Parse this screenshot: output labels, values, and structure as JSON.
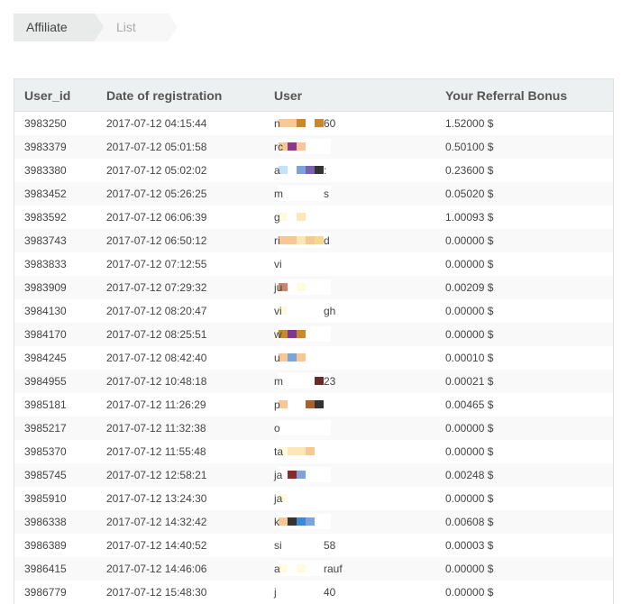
{
  "breadcrumb": {
    "items": [
      "Affiliate",
      "List"
    ]
  },
  "table": {
    "headers": [
      "User_id",
      "Date of registration",
      "User",
      "Your Referral Bonus"
    ],
    "rows": [
      {
        "id": "3983250",
        "date": "2017-07-12 04:15:44",
        "user_pre": "n",
        "user_suf": "60",
        "bonus": "1.52000 $",
        "blocks": [
          "#f5c896",
          "#f5c896",
          "#c8882d",
          "#ffffff",
          "#c8882d"
        ]
      },
      {
        "id": "3983379",
        "date": "2017-07-12 05:01:58",
        "user_pre": "rc",
        "user_suf": "",
        "bonus": "0.50100 $",
        "blocks": [
          "#f5c896",
          "#8b3a8f",
          "#f5c896"
        ]
      },
      {
        "id": "3983380",
        "date": "2017-07-12 05:02:02",
        "user_pre": "a",
        "user_suf": ":",
        "bonus": "0.23600 $",
        "blocks": [
          "#c5e3f7",
          "#ffffff",
          "#7aa5d8",
          "#7a62b0",
          "#333333"
        ]
      },
      {
        "id": "3983452",
        "date": "2017-07-12 05:26:25",
        "user_pre": "m",
        "user_suf": "s",
        "bonus": "0.05020 $",
        "blocks": []
      },
      {
        "id": "3983592",
        "date": "2017-07-12 06:06:39",
        "user_pre": "g",
        "user_suf": "",
        "bonus": "1.00093 $",
        "blocks": [
          "#fffbe0",
          "#ffffff",
          "#fde7b8"
        ]
      },
      {
        "id": "3983743",
        "date": "2017-07-12 06:50:12",
        "user_pre": "ri",
        "user_suf": "d",
        "bonus": "0.00000 $",
        "blocks": [
          "#f5c896",
          "#f5c896",
          "#fde7b8",
          "#f5c896",
          "#f5d890"
        ]
      },
      {
        "id": "3983833",
        "date": "2017-07-12 07:12:55",
        "user_pre": "vi",
        "user_suf": "",
        "bonus": "0.00000 $",
        "blocks": []
      },
      {
        "id": "3983909",
        "date": "2017-07-12 07:29:32",
        "user_pre": "ju",
        "user_suf": "",
        "bonus": "0.00209 $",
        "blocks": [
          "#c8866a",
          "#ffffff",
          "#fffbe0"
        ]
      },
      {
        "id": "3984130",
        "date": "2017-07-12 08:20:47",
        "user_pre": "vi",
        "user_suf": "gh",
        "bonus": "0.00000 $",
        "blocks": [
          "#fffbe0"
        ]
      },
      {
        "id": "3984170",
        "date": "2017-07-12 08:25:51",
        "user_pre": "w",
        "user_suf": "",
        "bonus": "0.00000 $",
        "blocks": [
          "#c8882d",
          "#7a3a8f",
          "#c8882d"
        ]
      },
      {
        "id": "3984245",
        "date": "2017-07-12 08:42:40",
        "user_pre": "u",
        "user_suf": "",
        "bonus": "0.00010 $",
        "blocks": [
          "#f5c896",
          "#7aa5d8",
          "#f5c896"
        ]
      },
      {
        "id": "3984955",
        "date": "2017-07-12 10:48:18",
        "user_pre": "m",
        "user_suf": "23",
        "bonus": "0.00021 $",
        "blocks": [
          "#ffffff",
          "#ffffff",
          "#ffffff",
          "#ffffff",
          "#6a2a2a"
        ]
      },
      {
        "id": "3985181",
        "date": "2017-07-12 11:26:29",
        "user_pre": "p",
        "user_suf": "",
        "bonus": "0.00465 $",
        "blocks": [
          "#f5c896",
          "#ffffff",
          "#ffffff",
          "#a8622d",
          "#333333"
        ]
      },
      {
        "id": "3985217",
        "date": "2017-07-12 11:32:38",
        "user_pre": "o",
        "user_suf": "",
        "bonus": "0.00000 $",
        "blocks": []
      },
      {
        "id": "3985370",
        "date": "2017-07-12 11:55:48",
        "user_pre": "ta",
        "user_suf": "",
        "bonus": "0.00000 $",
        "blocks": [
          "#fffbe0",
          "#fde7b8",
          "#fde7b8",
          "#f5c896"
        ]
      },
      {
        "id": "3985745",
        "date": "2017-07-12 12:58:21",
        "user_pre": "ja",
        "user_suf": "",
        "bonus": "0.00248 $",
        "blocks": [
          "#ffffff",
          "#8b2a2a",
          "#7aa5d8"
        ]
      },
      {
        "id": "3985910",
        "date": "2017-07-12 13:24:30",
        "user_pre": "ja",
        "user_suf": "",
        "bonus": "0.00000 $",
        "blocks": [
          "#fffbe0"
        ]
      },
      {
        "id": "3986338",
        "date": "2017-07-12 14:32:42",
        "user_pre": "k",
        "user_suf": "",
        "bonus": "0.00608 $",
        "blocks": [
          "#f5c896",
          "#333333",
          "#3a8ad8",
          "#7aa5d8"
        ]
      },
      {
        "id": "3986389",
        "date": "2017-07-12 14:40:52",
        "user_pre": "si",
        "user_suf": "58",
        "bonus": "0.00003 $",
        "blocks": []
      },
      {
        "id": "3986415",
        "date": "2017-07-12 14:46:06",
        "user_pre": "a",
        "user_suf": "rauf",
        "bonus": "0.00000 $",
        "blocks": [
          "#fffbe0",
          "#ffffff",
          "#fffbe0"
        ]
      },
      {
        "id": "3986779",
        "date": "2017-07-12 15:48:30",
        "user_pre": "j",
        "user_suf": "40",
        "bonus": "0.00000 $",
        "blocks": []
      }
    ]
  }
}
